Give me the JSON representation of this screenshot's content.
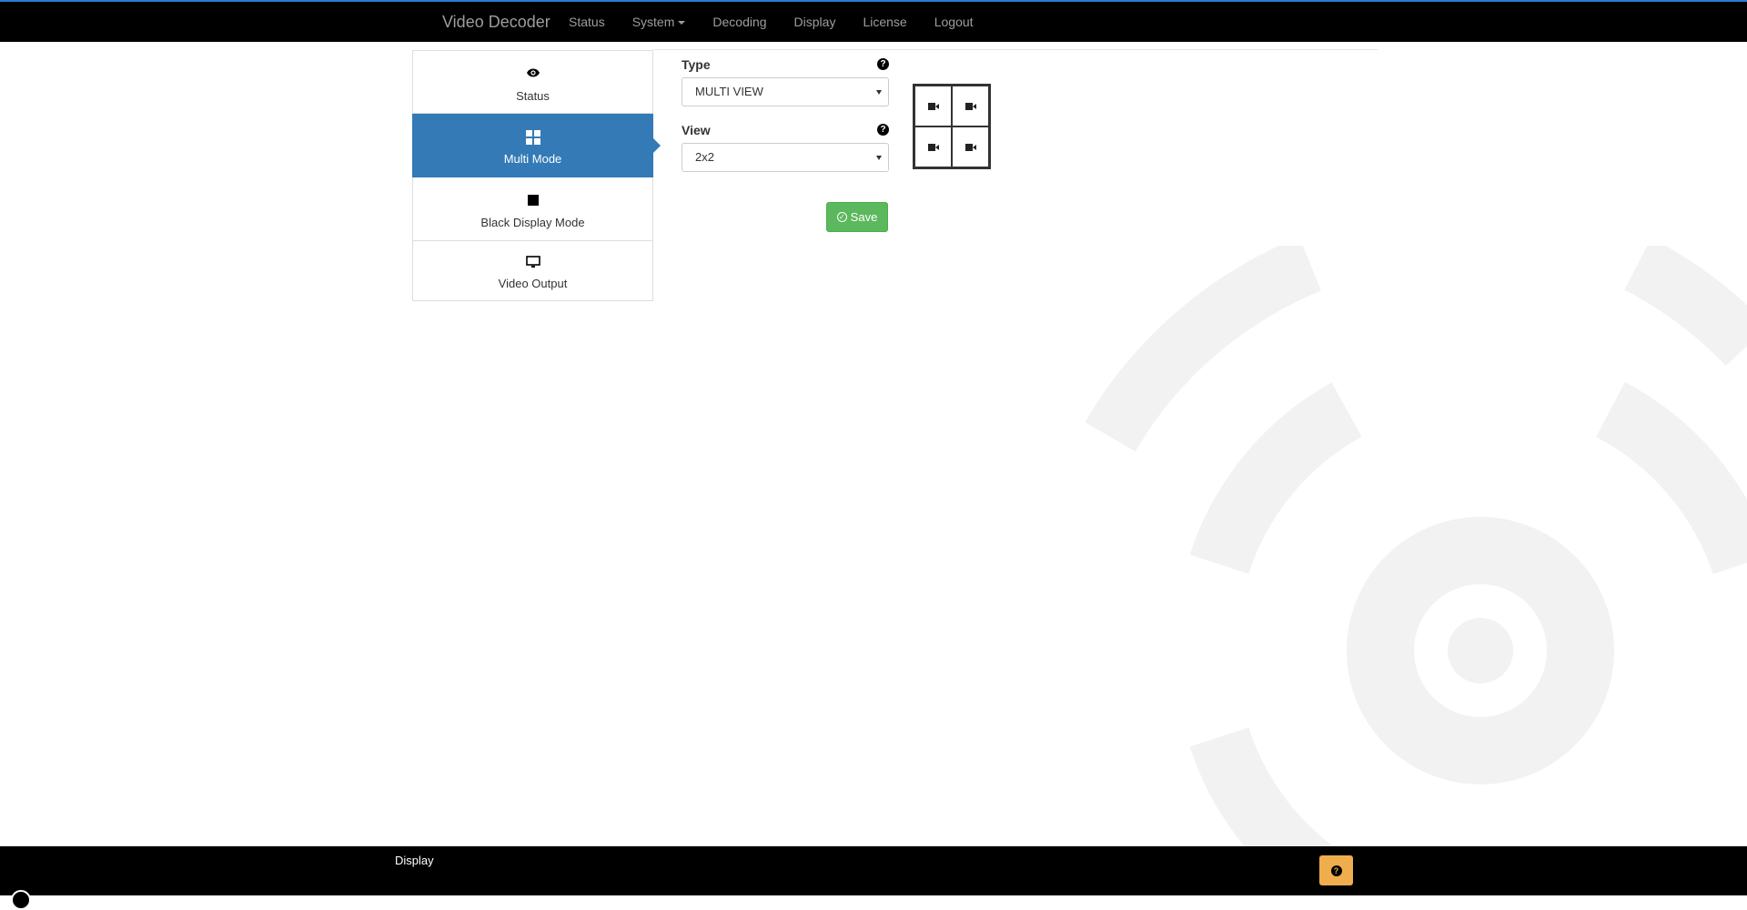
{
  "navbar": {
    "brand": "Video Decoder",
    "items": [
      {
        "label": "Status"
      },
      {
        "label": "System"
      },
      {
        "label": "Decoding"
      },
      {
        "label": "Display"
      },
      {
        "label": "License"
      },
      {
        "label": "Logout"
      }
    ]
  },
  "sidebar": {
    "items": [
      {
        "label": "Status",
        "icon": "eye-icon"
      },
      {
        "label": "Multi Mode",
        "icon": "grid-icon",
        "active": true
      },
      {
        "label": "Black Display Mode",
        "icon": "square-icon"
      },
      {
        "label": "Video Output",
        "icon": "monitor-icon"
      }
    ]
  },
  "form": {
    "type_label": "Type",
    "type_value": "MULTI VIEW",
    "view_label": "View",
    "view_value": "2x2",
    "help_glyph": "?",
    "save_label": "Save"
  },
  "preview": {
    "cells": [
      "camera-icon",
      "camera-icon",
      "camera-icon",
      "camera-icon"
    ]
  },
  "footer": {
    "title": "Display",
    "help_glyph": "?"
  },
  "colors": {
    "accent": "#337ab7",
    "save": "#5cb85c",
    "help": "#f0ad4e",
    "navbar": "#000000",
    "navbar_top_border": "#2b7bd0"
  }
}
